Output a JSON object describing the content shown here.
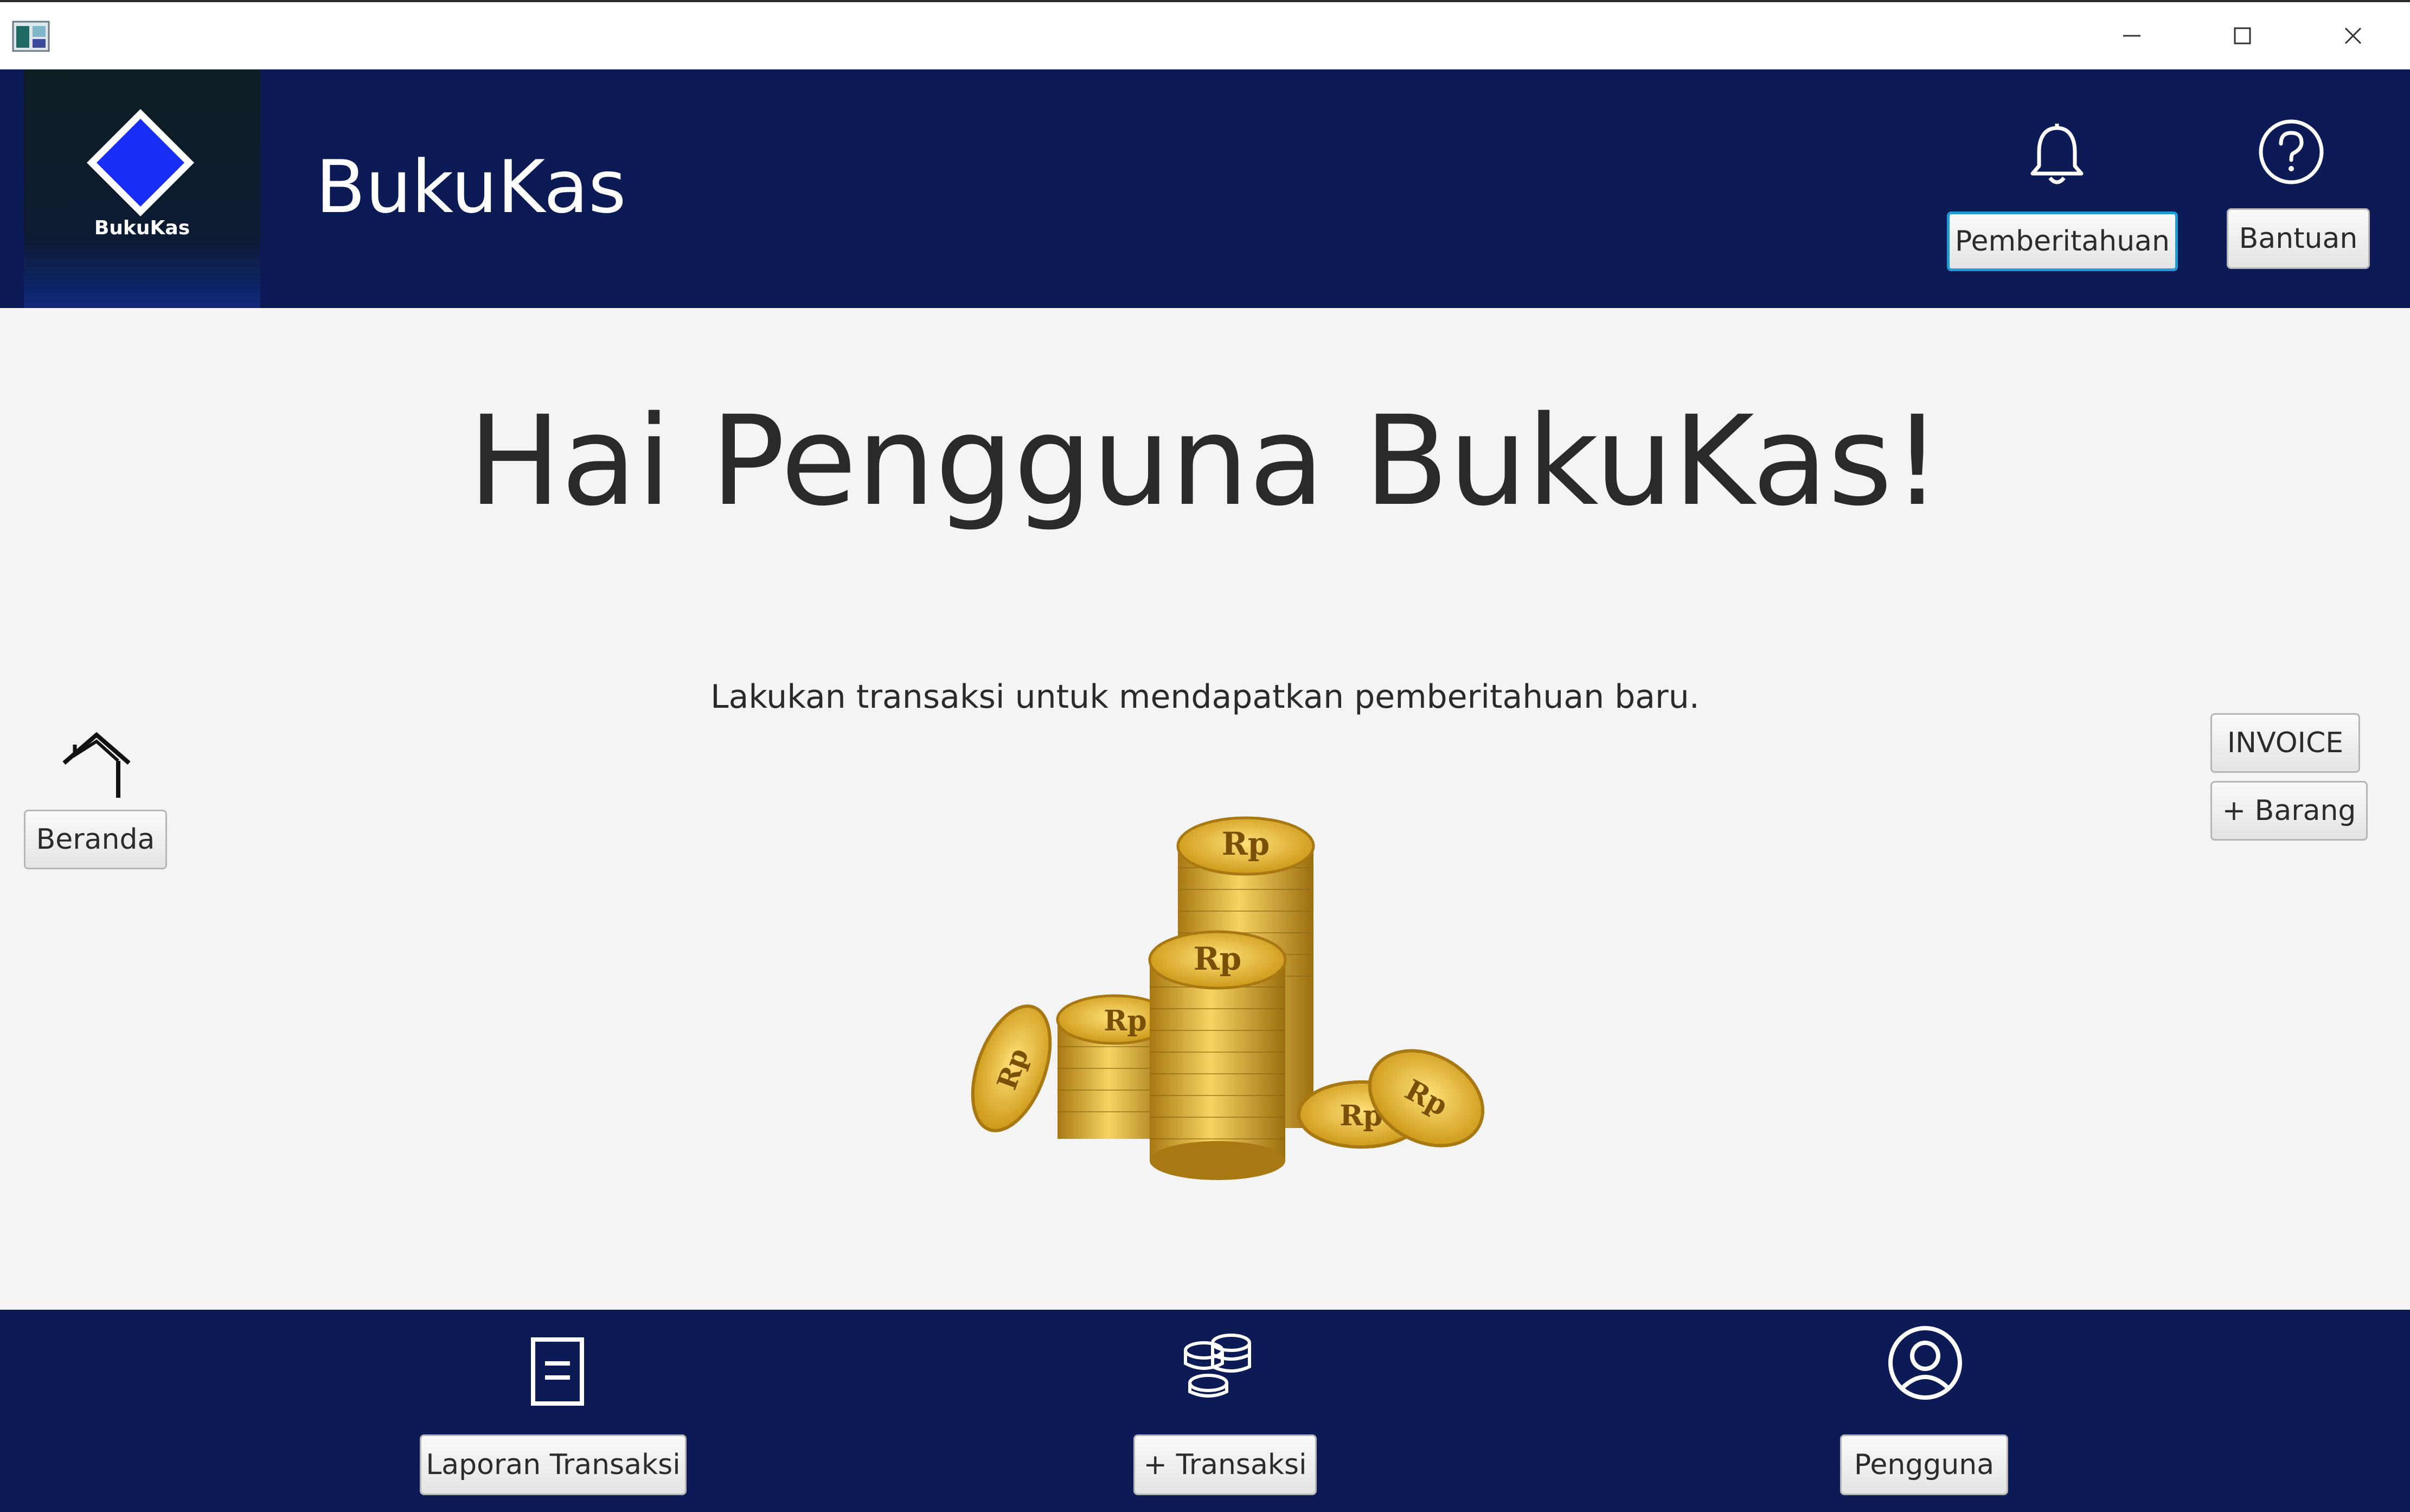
{
  "window": {
    "minimize_icon": "minimize-icon",
    "maximize_icon": "maximize-icon",
    "close_icon": "close-icon"
  },
  "header": {
    "logo_text": "BukuKas",
    "app_title": "BukuKas",
    "notification_label": "Pemberitahuan",
    "help_label": "Bantuan",
    "bell_icon": "bell-icon",
    "help_icon": "question-circle-icon"
  },
  "main": {
    "greeting": "Hai Pengguna BukuKas!",
    "message": "Lakukan transaksi untuk mendapatkan pemberitahuan baru.",
    "home_label": "Beranda",
    "invoice_label": "INVOICE",
    "add_item_label": "+ Barang",
    "coin_label": "Rp"
  },
  "footer": {
    "report_label": "Laporan Transaksi",
    "add_transaction_label": "+ Transaksi",
    "user_label": "Pengguna"
  },
  "colors": {
    "navy": "#0c1a55",
    "logo_blue": "#1a2ff5",
    "focus_border": "#1e9bd7",
    "coin_gold": "#e0b02a"
  }
}
